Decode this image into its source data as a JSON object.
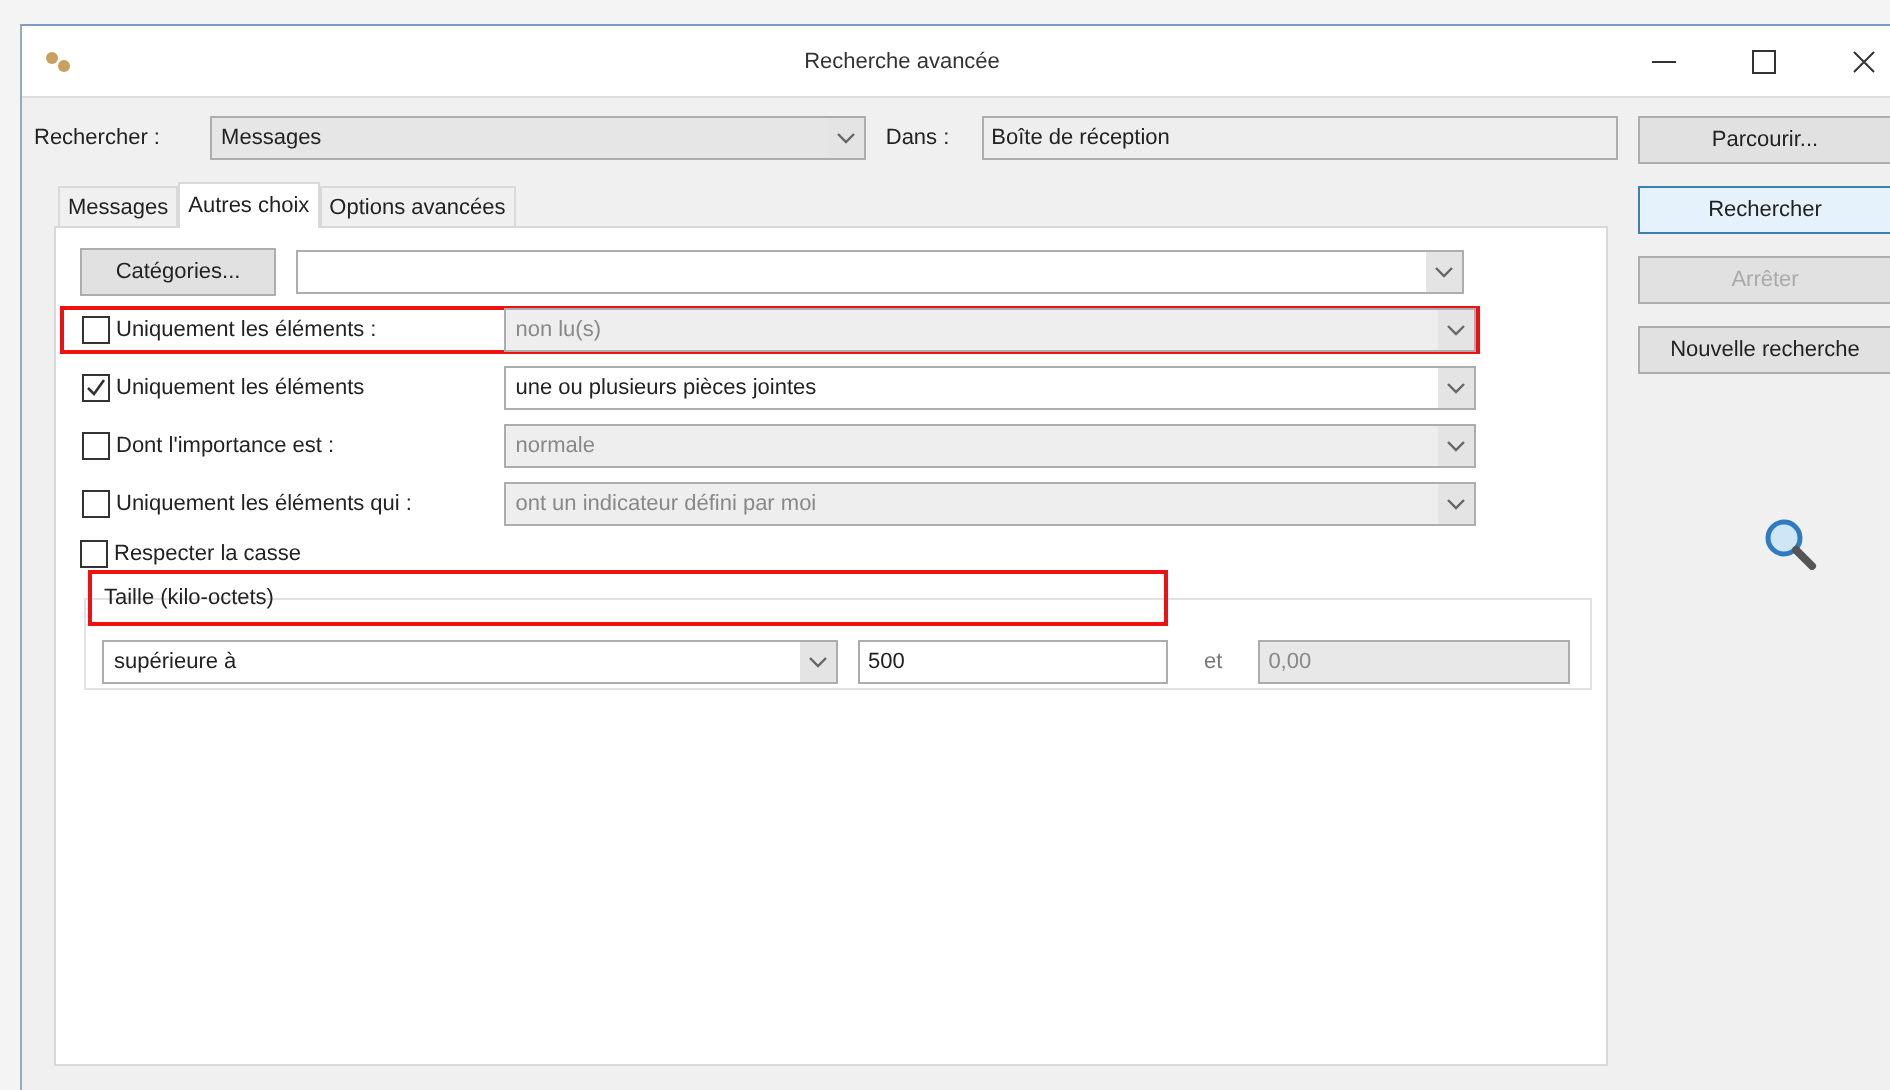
{
  "window": {
    "title": "Recherche avancée"
  },
  "search_for": {
    "label": "Rechercher :",
    "value": "Messages"
  },
  "in": {
    "label": "Dans :",
    "value": "Boîte de réception"
  },
  "tabs": [
    {
      "label": "Messages",
      "selected": false
    },
    {
      "label": "Autres choix",
      "selected": true
    },
    {
      "label": "Options avancées",
      "selected": false
    }
  ],
  "categories": {
    "button": "Catégories..."
  },
  "criteria": [
    {
      "label": "Uniquement les éléments :",
      "checked": false,
      "value": "non lu(s)",
      "highlighted": true
    },
    {
      "label": "Uniquement les éléments",
      "checked": true,
      "value": "une ou plusieurs pièces jointes",
      "highlighted": false
    },
    {
      "label": "Dont l'importance est :",
      "checked": false,
      "value": "normale",
      "highlighted": false
    },
    {
      "label": "Uniquement les éléments qui :",
      "checked": false,
      "value": "ont un indicateur défini par moi",
      "highlighted": false
    }
  ],
  "match_case": {
    "label": "Respecter la casse",
    "checked": false
  },
  "size": {
    "title": "Taille (kilo-octets)",
    "highlighted": true,
    "condition": "supérieure à",
    "from": "500",
    "and": "et",
    "to": "0,00"
  },
  "buttons": [
    {
      "label": "Parcourir...",
      "disabled": false,
      "focused": false
    },
    {
      "label": "Rechercher",
      "disabled": false,
      "focused": true
    },
    {
      "label": "Arrêter",
      "disabled": true,
      "focused": false
    },
    {
      "label": "Nouvelle recherche",
      "disabled": false,
      "focused": false
    }
  ]
}
